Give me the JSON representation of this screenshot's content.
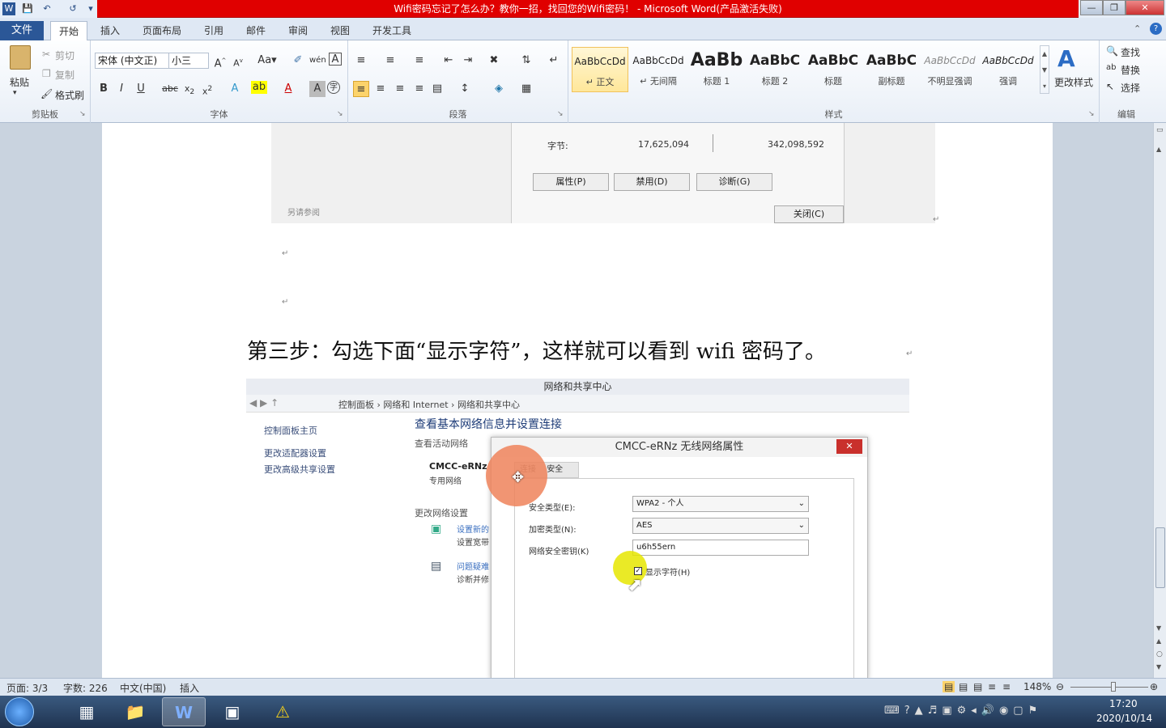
{
  "window": {
    "title": "Wifi密码忘记了怎么办？教你一招，找回您的Wifi密码！ - Microsoft Word(产品激活失败)"
  },
  "tabs": {
    "file": "文件",
    "items": [
      "开始",
      "插入",
      "页面布局",
      "引用",
      "邮件",
      "审阅",
      "视图",
      "开发工具"
    ]
  },
  "clipboard": {
    "paste": "粘贴",
    "cut": "剪切",
    "copy": "复制",
    "format_painter": "格式刷",
    "group": "剪贴板"
  },
  "font": {
    "name": "宋体 (中文正)",
    "size": "小三",
    "group": "字体"
  },
  "paragraph": {
    "group": "段落"
  },
  "styles": {
    "group": "样式",
    "change": "更改样式",
    "items": [
      {
        "preview": "AaBbCcDd",
        "name": "↵ 正文"
      },
      {
        "preview": "AaBbCcDd",
        "name": "↵ 无间隔"
      },
      {
        "preview": "AaBb",
        "name": "标题 1"
      },
      {
        "preview": "AaBbC",
        "name": "标题 2"
      },
      {
        "preview": "AaBbC",
        "name": "标题"
      },
      {
        "preview": "AaBbC",
        "name": "副标题"
      },
      {
        "preview": "AaBbCcDd",
        "name": "不明显强调"
      },
      {
        "preview": "AaBbCcDd",
        "name": "强调"
      }
    ]
  },
  "editing": {
    "find": "查找",
    "replace": "替换",
    "select": "选择",
    "group": "编辑"
  },
  "doc": {
    "shot1": {
      "bytes_label": "字节:",
      "bytes_sent": "17,625,094",
      "bytes_recv": "342,098,592",
      "btn_props": "属性(P)",
      "btn_disable": "禁用(D)",
      "btn_diag": "诊断(G)",
      "see_also": "另请参阅",
      "btn_close": "关闭(C)"
    },
    "heading": "第三步：勾选下面“显示字符”，这样就可以看到 wifi 密码了。",
    "shot2": {
      "win_title": "网络和共享中心",
      "breadcrumb": "控制面板 › 网络和 Internet › 网络和共享中心",
      "left_links": [
        "控制面板主页",
        "更改适配器设置",
        "更改高级共享设置"
      ],
      "main_title": "查看基本网络信息并设置连接",
      "active_net": "查看活动网络",
      "net_name": "CMCC-eRNz",
      "net_type": "专用网络",
      "change_label": "更改网络设置",
      "link1a": "设置新的",
      "link1b": "设置宽带",
      "link2a": "问题疑难",
      "link2b": "诊断并修",
      "dialog_title": "CMCC-eRNz 无线网络属性",
      "tab_conn": "连接",
      "tab_sec": "安全",
      "sec_type_label": "安全类型(E):",
      "sec_type": "WPA2 - 个人",
      "enc_type_label": "加密类型(N):",
      "enc_type": "AES",
      "key_label": "网络安全密钥(K)",
      "key": "u6h55ern",
      "show_chars": "显示字符(H)"
    }
  },
  "status": {
    "page": "页面: 3/3",
    "words": "字数: 226",
    "lang": "中文(中国)",
    "mode": "插入",
    "zoom": "148%"
  },
  "clock": {
    "time": "17:20",
    "date": "2020/10/14"
  }
}
